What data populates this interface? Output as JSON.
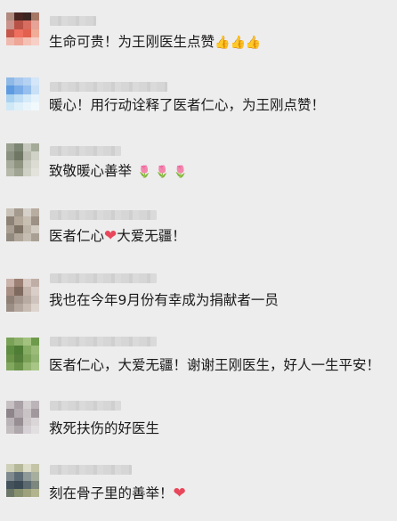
{
  "comments": [
    {
      "text": "生命可贵！为王刚医生点赞",
      "emoji": "👍👍👍"
    },
    {
      "text": "暖心！用行动诠释了医者仁心，为王刚点赞！"
    },
    {
      "text": "致敬暖心善举",
      "emoji": "🌷 🌷 🌷"
    },
    {
      "text_before": "医者仁心",
      "emoji": "❤",
      "text_after": "大爱无疆！"
    },
    {
      "text": "我也在今年9月份有幸成为捐献者一员"
    },
    {
      "text": "医者仁心，大爱无疆！谢谢王刚医生，好人一生平安！"
    },
    {
      "text": "救死扶伤的好医生"
    },
    {
      "text": "刻在骨子里的善举！",
      "emoji": "❤"
    }
  ]
}
